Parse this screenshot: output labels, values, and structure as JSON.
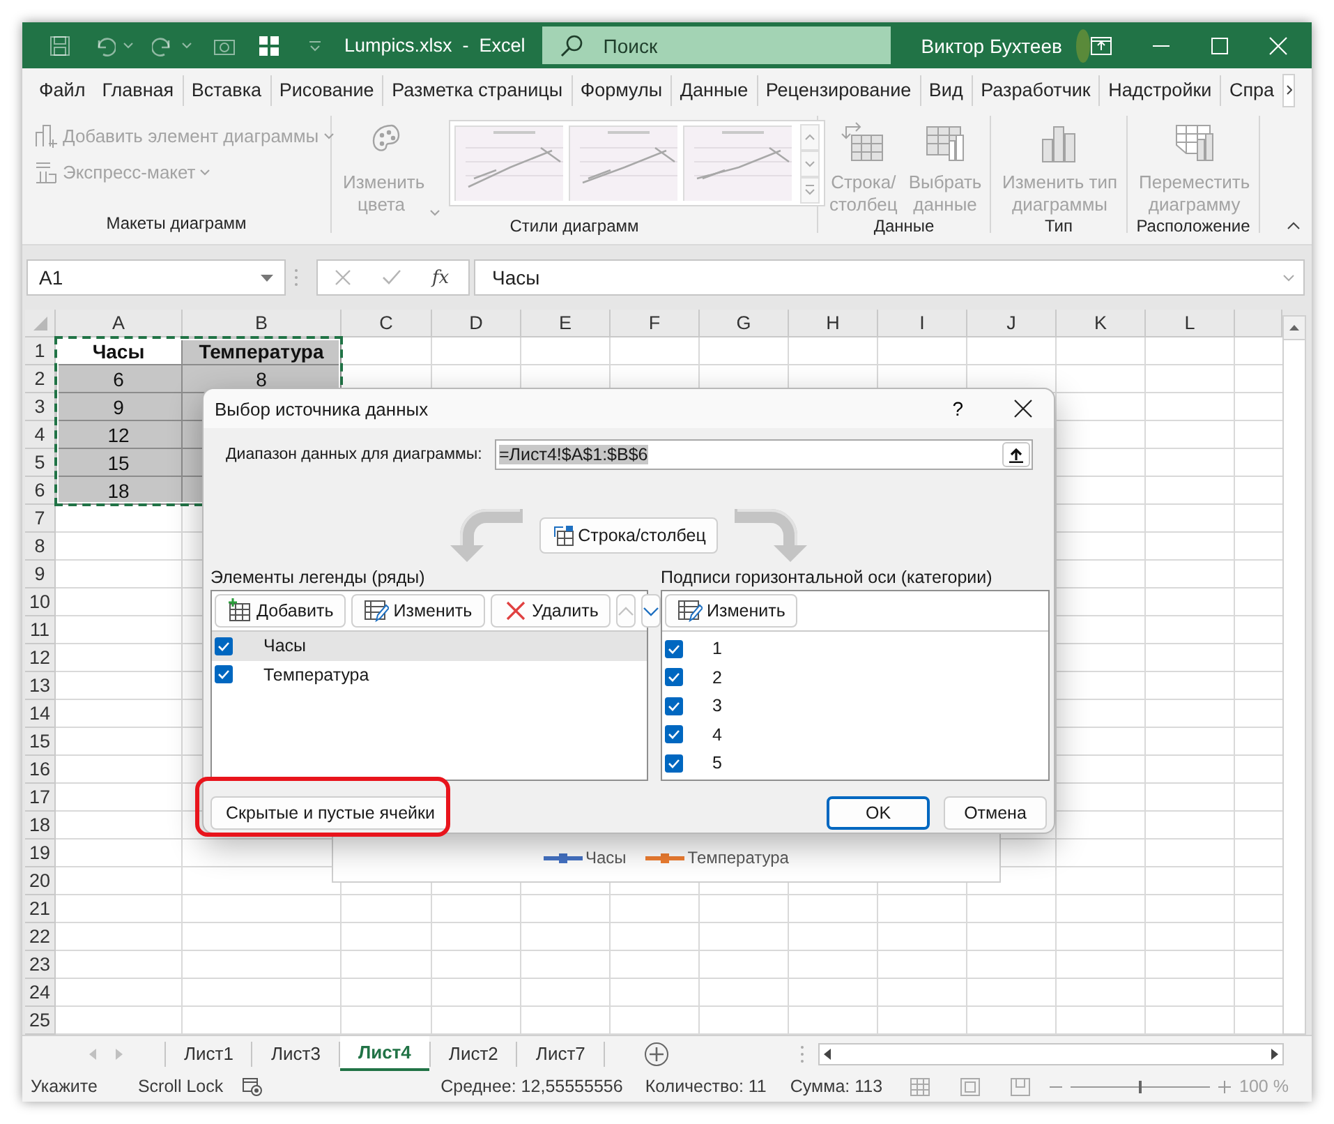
{
  "title_bar": {
    "title": "Lumpics.xlsx  -  Excel",
    "search": {
      "placeholder": "Поиск"
    },
    "user_name": "Виктор Бухтеев"
  },
  "ribbon": {
    "tabs": [
      "Файл",
      "Главная",
      "Вставка",
      "Рисование",
      "Разметка страницы",
      "Формулы",
      "Данные",
      "Рецензирование",
      "Вид",
      "Разработчик",
      "Надстройки",
      "Спра"
    ],
    "groups": [
      {
        "label": "Макеты диаграмм",
        "items": [
          {
            "kind": "small",
            "label": "Добавить элемент диаграммы",
            "dropdown": true,
            "disabled": true
          },
          {
            "kind": "small",
            "label": "Экспресс-макет",
            "dropdown": true,
            "disabled": true
          }
        ]
      },
      {
        "label": "Стили диаграмм",
        "items": [
          {
            "kind": "large",
            "label": "Изменить\nцвета",
            "dropdown": true,
            "disabled": true
          },
          {
            "kind": "gallery"
          }
        ]
      },
      {
        "label": "Данные",
        "items": [
          {
            "kind": "large",
            "label": "Строка/\nстолбец",
            "dropdown": false,
            "disabled": true
          },
          {
            "kind": "large",
            "label": "Выбрать\nданные",
            "dropdown": false,
            "disabled": true
          }
        ]
      },
      {
        "label": "Тип",
        "items": [
          {
            "kind": "large",
            "label": "Изменить тип\nдиаграммы",
            "dropdown": false,
            "disabled": true
          }
        ]
      },
      {
        "label": "Расположение",
        "items": [
          {
            "kind": "large",
            "label": "Переместить\nдиаграмму",
            "dropdown": false,
            "disabled": true
          }
        ]
      }
    ]
  },
  "formula_bar": {
    "name_box": "A1",
    "function_label": "fx",
    "formula": "Часы"
  },
  "grid": {
    "columns": [
      "A",
      "B",
      "C",
      "D",
      "E",
      "F",
      "G",
      "H",
      "I",
      "J",
      "K",
      "L"
    ],
    "row_headers": [
      "1",
      "2",
      "3",
      "4",
      "5",
      "6",
      "7",
      "8",
      "9",
      "10",
      "11",
      "12",
      "13",
      "14",
      "15",
      "16",
      "17",
      "18",
      "19",
      "20",
      "21",
      "22",
      "23",
      "24",
      "25"
    ],
    "marquee": true,
    "rows": [
      {
        "kind": "header",
        "cells": [
          {
            "text": "Часы",
            "selected": true,
            "active": true
          },
          {
            "text": "Температура",
            "selected": true,
            "active": false
          }
        ]
      },
      {
        "kind": "data",
        "cells": [
          {
            "text": "6",
            "selected": true,
            "active": false
          },
          {
            "text": "8",
            "selected": true,
            "active": false
          }
        ]
      },
      {
        "kind": "data",
        "cells": [
          {
            "text": "9",
            "selected": true,
            "active": false
          },
          {
            "selected": true,
            "active": false
          }
        ]
      },
      {
        "kind": "data",
        "cells": [
          {
            "text": "12",
            "selected": true,
            "active": false
          },
          {
            "selected": true,
            "active": false
          }
        ]
      },
      {
        "kind": "data",
        "cells": [
          {
            "text": "15",
            "selected": true,
            "active": false
          },
          {
            "selected": true,
            "active": false
          }
        ]
      },
      {
        "kind": "data",
        "cells": [
          {
            "text": "18",
            "selected": true,
            "active": false
          },
          {
            "selected": true,
            "active": false
          }
        ]
      }
    ]
  },
  "chart": {
    "legend": [
      {
        "label": "Часы",
        "color": "#4472c4"
      },
      {
        "label": "Температура",
        "color": "#ed7d31"
      }
    ]
  },
  "dialog": {
    "title": "Выбор источника данных",
    "help": "?",
    "range_label": "Диапазон данных для диаграммы:",
    "range_value": "=Лист4!$A$1:$B$6",
    "switch_button": "Строка/столбец",
    "legend_panel": {
      "title": "Элементы легенды (ряды)",
      "buttons": [
        {
          "kind": "add",
          "label": "Добавить",
          "disabled": false
        },
        {
          "kind": "edit",
          "label": "Изменить",
          "disabled": false
        },
        {
          "kind": "delete",
          "label": "Удалить",
          "disabled": false
        },
        {
          "kind": "up",
          "disabled": true
        },
        {
          "kind": "down",
          "disabled": false
        }
      ],
      "items": [
        {
          "label": "Часы",
          "checked": true,
          "selected": true
        },
        {
          "label": "Температура",
          "checked": true,
          "selected": false
        }
      ]
    },
    "axis_panel": {
      "title": "Подписи горизонтальной оси (категории)",
      "buttons": [
        {
          "kind": "edit",
          "label": "Изменить",
          "disabled": false
        }
      ],
      "items": [
        {
          "label": "1",
          "checked": true,
          "selected": false
        },
        {
          "label": "2",
          "checked": true,
          "selected": false
        },
        {
          "label": "3",
          "checked": true,
          "selected": false
        },
        {
          "label": "4",
          "checked": true,
          "selected": false
        },
        {
          "label": "5",
          "checked": true,
          "selected": false
        }
      ]
    },
    "hidden_cells_button": {
      "label": "Скрытые и пустые ячейки",
      "highlighted": true
    },
    "ok_button": "OK",
    "cancel_button": "Отмена"
  },
  "sheet_tabs": [
    {
      "label": "Лист1",
      "selected": false
    },
    {
      "label": "Лист3",
      "selected": false
    },
    {
      "label": "Лист4",
      "selected": true
    },
    {
      "label": "Лист2",
      "selected": false
    },
    {
      "label": "Лист7",
      "selected": false
    }
  ],
  "status_bar": {
    "mode": "Укажите",
    "scroll_lock": "Scroll Lock",
    "average": "Среднее: 12,55555556",
    "count": "Количество: 11",
    "sum": "Сумма: 113",
    "zoom_slider": {
      "level": 0.5
    },
    "zoom": "100 %"
  }
}
